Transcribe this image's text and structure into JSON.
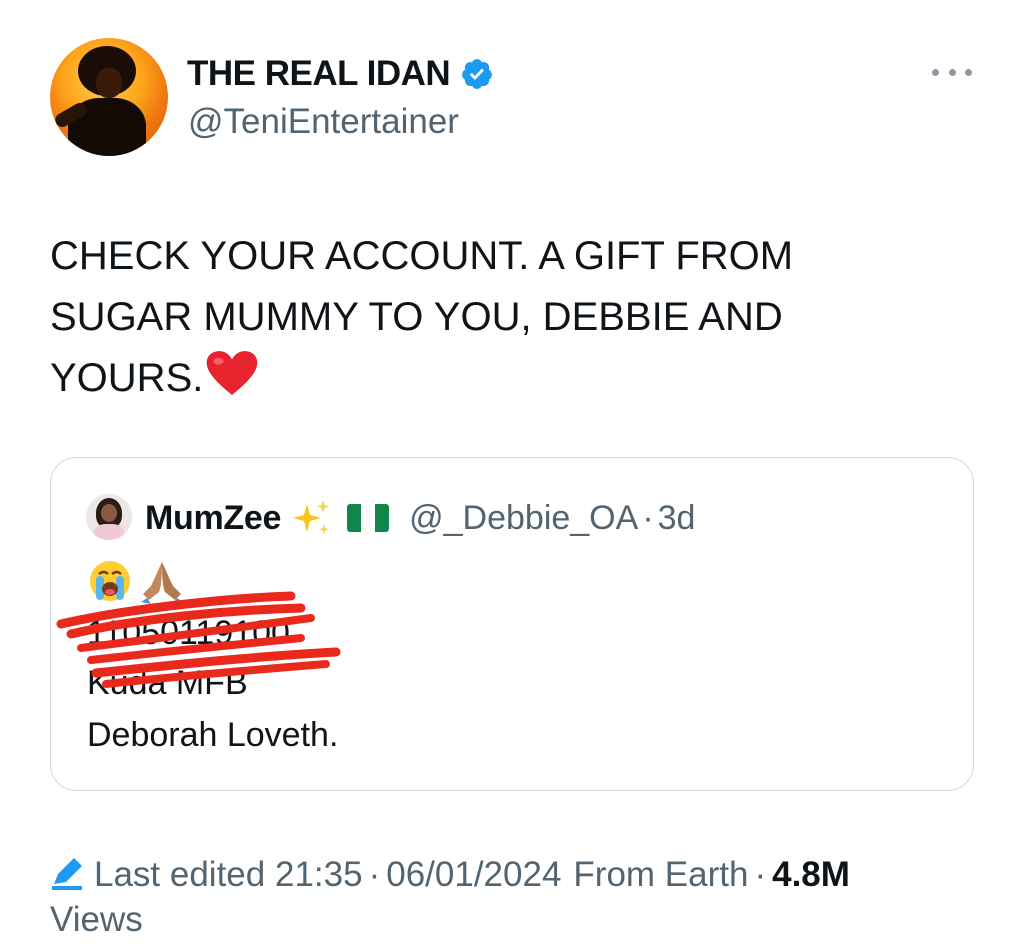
{
  "author": {
    "display_name": "THE REAL IDAN",
    "handle": "@TeniEntertainer",
    "verified_color": "#1d9bf0"
  },
  "tweet": {
    "lines": [
      "CHECK YOUR ACCOUNT. A GIFT FROM",
      "SUGAR MUMMY TO YOU, DEBBIE AND",
      "YOURS."
    ],
    "emoji": "red-heart"
  },
  "quoted": {
    "display_name": "MumZee",
    "name_emojis": [
      "sparkles",
      "nigeria-flag"
    ],
    "handle": "@_Debbie_OA",
    "separator": "·",
    "time": "3d",
    "emojis": [
      "loudly-crying-face",
      "folded-hands"
    ],
    "lines": [
      "11050119100",
      "Kuda MFB",
      "Deborah Loveth."
    ],
    "scribble_color": "#e8291c"
  },
  "footer": {
    "edited_label": "Last edited",
    "time": "21:35",
    "separator": "·",
    "date": "06/01/2024",
    "source": "From Earth",
    "views_count": "4.8M",
    "views_label": "Views"
  },
  "colors": {
    "text": "#0f1419",
    "secondary": "#536471",
    "border": "#cfd9de",
    "accent": "#1d9bf0"
  }
}
